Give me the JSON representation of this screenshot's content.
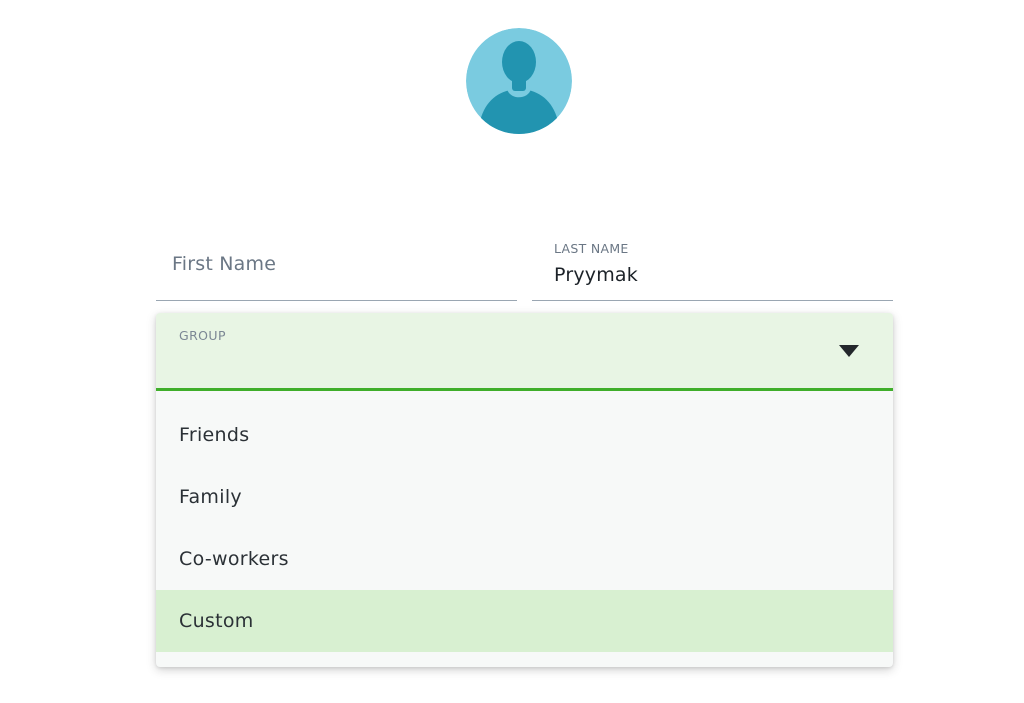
{
  "avatar": {
    "icon": "user-silhouette-icon",
    "colors": {
      "background": "#7acbe0",
      "figure": "#2294b0"
    }
  },
  "first_name": {
    "placeholder": "First Name",
    "value": ""
  },
  "last_name": {
    "label": "LAST NAME",
    "value": "Pryymak"
  },
  "group": {
    "label": "GROUP",
    "value": "",
    "expanded": true,
    "accent_color": "#3fae2a",
    "options": [
      {
        "label": "Friends",
        "selected": false
      },
      {
        "label": "Family",
        "selected": false
      },
      {
        "label": "Co-workers",
        "selected": false
      },
      {
        "label": "Custom",
        "selected": true
      }
    ]
  }
}
